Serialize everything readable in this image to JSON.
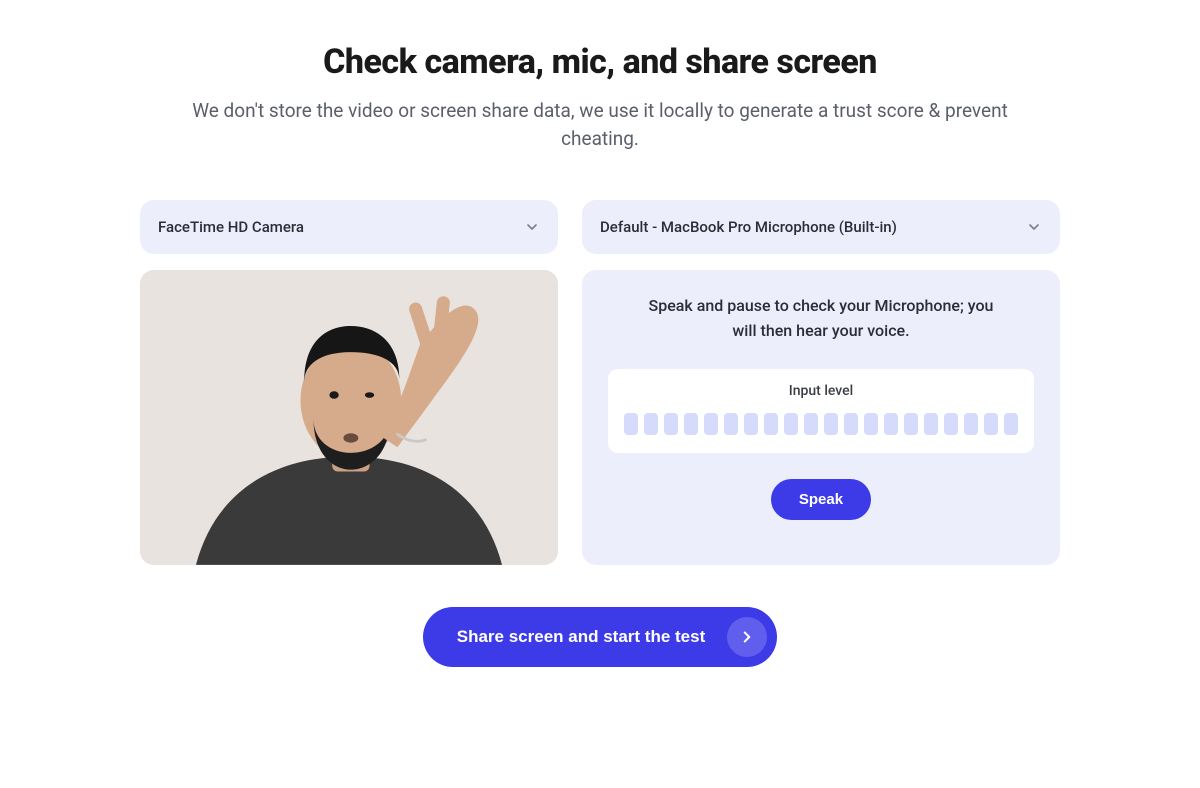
{
  "header": {
    "title": "Check camera, mic, and share screen",
    "subtitle": "We don't store the video or screen share data, we use it locally to generate a trust score & prevent cheating."
  },
  "camera": {
    "selected": "FaceTime HD Camera"
  },
  "mic": {
    "selected": "Default - MacBook Pro Microphone (Built-in)",
    "instruction": "Speak and pause to check your Microphone; you will then hear your voice.",
    "level_label": "Input level",
    "bars": 20,
    "speak_label": "Speak"
  },
  "start": {
    "label": "Share screen and start the test"
  }
}
